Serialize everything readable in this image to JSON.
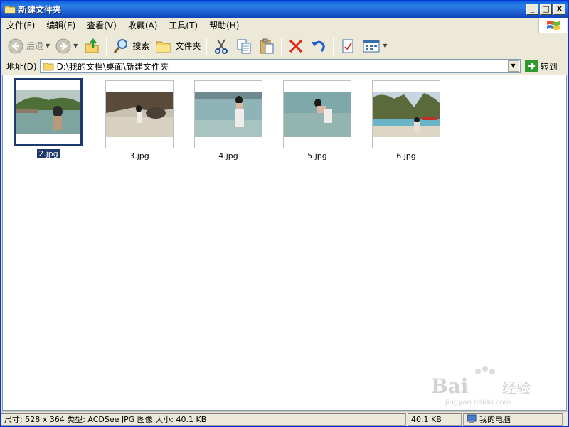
{
  "window": {
    "title": "新建文件夹",
    "minimize": "_",
    "maximize": "□",
    "close": "X"
  },
  "menu": {
    "items": [
      "文件(F)",
      "编辑(E)",
      "查看(V)",
      "收藏(A)",
      "工具(T)",
      "帮助(H)"
    ]
  },
  "toolbar": {
    "back_label": "后退",
    "search_label": "搜索",
    "folders_label": "文件夹"
  },
  "address": {
    "label": "地址(D)",
    "path": "D:\\我的文档\\桌面\\新建文件夹",
    "go_label": "转到"
  },
  "files": [
    {
      "name": "2.jpg",
      "selected": true
    },
    {
      "name": "3.jpg",
      "selected": false
    },
    {
      "name": "4.jpg",
      "selected": false
    },
    {
      "name": "5.jpg",
      "selected": false
    },
    {
      "name": "6.jpg",
      "selected": false
    }
  ],
  "watermark": {
    "logo_text": "Bai",
    "logo_text2": "经验",
    "url": "jingyan.baidu.com"
  },
  "status": {
    "info": "尺寸: 528 x 364 类型: ACDSee JPG 图像 大小: 40.1 KB",
    "size": "40.1 KB",
    "location": "我的电脑"
  },
  "colors": {
    "titlebar": "#0a5fd8",
    "selection": "#1c3a6e",
    "chrome": "#ece9d8"
  }
}
